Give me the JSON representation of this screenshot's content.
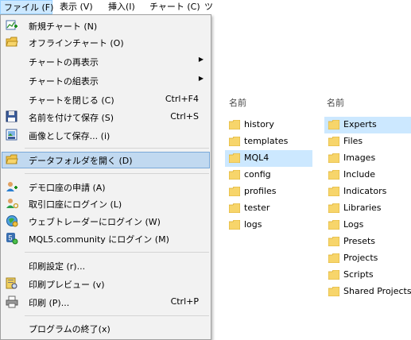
{
  "menubar": {
    "items": [
      {
        "label": "ファイル (F)"
      },
      {
        "label": "表示 (V)"
      },
      {
        "label": "挿入(I)"
      },
      {
        "label": "チャート (C)"
      },
      {
        "label": "ツ"
      }
    ]
  },
  "file_menu": {
    "items": [
      {
        "label": "新規チャート (N)",
        "shortcut": "",
        "icon": "new-chart-icon"
      },
      {
        "label": "オフラインチャート (O)",
        "shortcut": "",
        "icon": "offline-chart-icon"
      },
      {
        "label": "チャートの再表示",
        "shortcut": "",
        "submenu": true
      },
      {
        "label": "チャートの組表示",
        "shortcut": "",
        "submenu": true
      },
      {
        "label": "チャートを閉じる (C)",
        "shortcut": "Ctrl+F4"
      },
      {
        "label": "名前を付けて保存 (S)",
        "shortcut": "Ctrl+S",
        "icon": "save-icon"
      },
      {
        "label": "画像として保存... (i)",
        "shortcut": "",
        "icon": "save-image-icon"
      },
      {
        "label": "データフォルダを開く (D)",
        "shortcut": "",
        "icon": "open-folder-icon",
        "highlighted": true
      },
      {
        "label": "デモ口座の申請 (A)",
        "shortcut": "",
        "icon": "demo-account-icon"
      },
      {
        "label": "取引口座にログイン (L)",
        "shortcut": "",
        "icon": "login-account-icon"
      },
      {
        "label": "ウェブトレーダーにログイン (W)",
        "shortcut": "",
        "icon": "webtrader-icon"
      },
      {
        "label": "MQL5.community にログイン (M)",
        "shortcut": "",
        "icon": "mql5-icon"
      },
      {
        "label": "印刷設定 (r)...",
        "shortcut": ""
      },
      {
        "label": "印刷プレビュー (v)",
        "shortcut": "",
        "icon": "print-preview-icon"
      },
      {
        "label": "印刷 (P)...",
        "shortcut": "Ctrl+P",
        "icon": "print-icon"
      },
      {
        "label": "プログラムの終了(x)",
        "shortcut": ""
      }
    ]
  },
  "explorer_left": {
    "header": "名前",
    "folders": [
      {
        "name": "history"
      },
      {
        "name": "templates"
      },
      {
        "name": "MQL4",
        "selected": true
      },
      {
        "name": "config"
      },
      {
        "name": "profiles"
      },
      {
        "name": "tester"
      },
      {
        "name": "logs"
      }
    ]
  },
  "explorer_right": {
    "header": "名前",
    "folders": [
      {
        "name": "Experts",
        "selected": true
      },
      {
        "name": "Files"
      },
      {
        "name": "Images"
      },
      {
        "name": "Include"
      },
      {
        "name": "Indicators"
      },
      {
        "name": "Libraries"
      },
      {
        "name": "Logs"
      },
      {
        "name": "Presets"
      },
      {
        "name": "Projects"
      },
      {
        "name": "Scripts"
      },
      {
        "name": "Shared Projects"
      }
    ]
  },
  "colors": {
    "highlight": "#c1d9f0",
    "selection": "#cce8ff",
    "folder": "#f7d56b"
  }
}
